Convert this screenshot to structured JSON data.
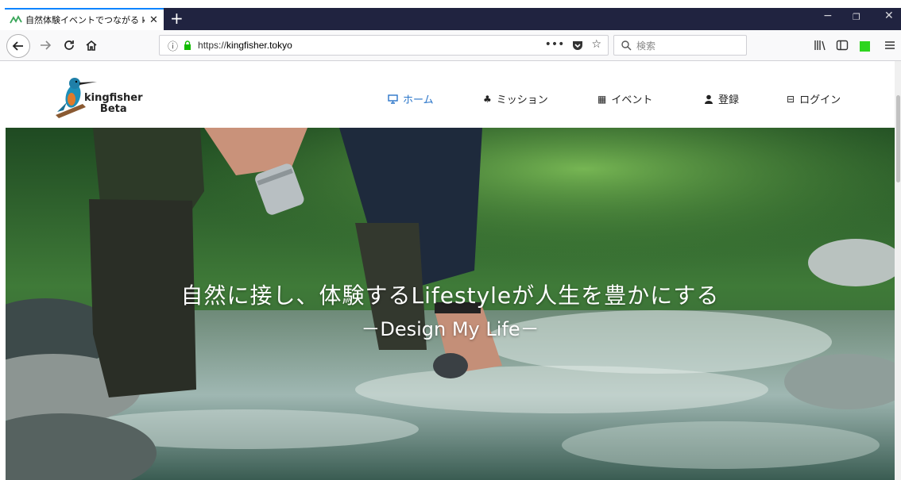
{
  "browser": {
    "tab_title": "自然体験イベントでつながる kingfi",
    "tab_close": "✕",
    "new_tab": "+",
    "url_scheme": "https://",
    "url_host": "kingfisher.tokyo",
    "search_placeholder": "検索",
    "url_actions": [
      "•••",
      "♡",
      "☆"
    ],
    "window_controls": [
      "−",
      "❐",
      "✕"
    ]
  },
  "site": {
    "logo_text_line1": "kingfisher",
    "logo_text_line2": "Beta",
    "menu": [
      {
        "label": "ホーム",
        "icon": "monitor-icon",
        "glyph": "▭",
        "active": true
      },
      {
        "label": "ミッション",
        "icon": "tree-icon",
        "glyph": "♣",
        "active": false
      },
      {
        "label": "イベント",
        "icon": "calendar-icon",
        "glyph": "▦",
        "active": false
      },
      {
        "label": "登録",
        "icon": "user-icon",
        "glyph": "●",
        "active": false
      },
      {
        "label": "ログイン",
        "icon": "login-icon",
        "glyph": "⊟",
        "active": false
      }
    ]
  },
  "hero": {
    "title": "自然に接し、体験するLifestyleが人生を豊かにする",
    "subtitle": "－Design My Life－"
  },
  "colors": {
    "accent": "#2a75c9",
    "tabbar": "#202340",
    "tab_indicator": "#0a84ff",
    "extension_green": "#2ed51f"
  }
}
